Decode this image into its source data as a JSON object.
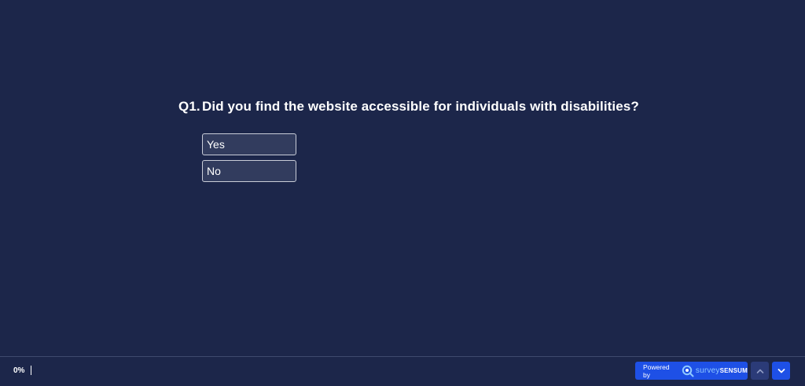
{
  "question": {
    "number": "Q1.",
    "text": "Did you find the website accessible for individuals with disabilities?",
    "options": [
      {
        "label": "Yes"
      },
      {
        "label": "No"
      }
    ]
  },
  "footer": {
    "progress_label": "0%",
    "progress_value": 0,
    "powered_by_label": "Powered by",
    "brand_part_a": "survey",
    "brand_part_b": "SENSUM",
    "nav_up_icon": "chevron-up-icon",
    "nav_down_icon": "chevron-down-icon"
  },
  "colors": {
    "background": "#1c264a",
    "option_fill": "#323c5e",
    "option_border": "#c9cdd8",
    "accent": "#1e50e6",
    "nav_up_fill": "#2b3b78"
  }
}
